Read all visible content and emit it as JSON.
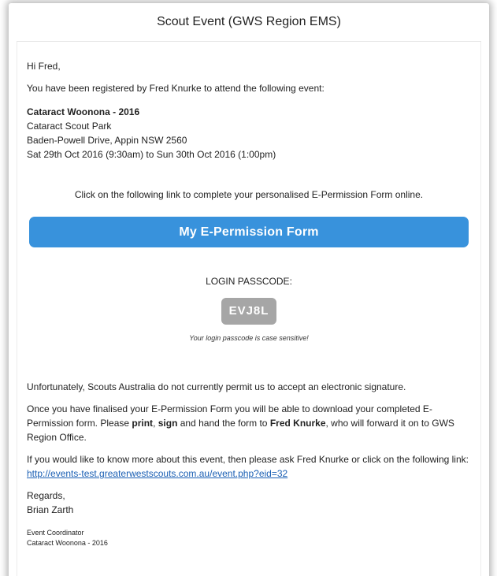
{
  "email": {
    "subject": "Scout Event (GWS Region EMS)",
    "greeting": "Hi Fred,",
    "intro": "You have been registered by Fred Knurke to attend the following event:",
    "event": {
      "name": "Cataract Woonona - 2016",
      "venue": "Cataract Scout Park",
      "address": "Baden-Powell Drive, Appin NSW 2560",
      "dates": "Sat 29th Oct 2016 (9:30am) to Sun 30th Oct 2016 (1:00pm)"
    },
    "link_instruction": "Click on the following link to complete your personalised E-Permission Form online.",
    "cta_label": "My E-Permission Form",
    "passcode_label": "LOGIN PASSCODE:",
    "passcode": "EVJ8L",
    "passcode_note": "Your login passcode is case sensitive!",
    "unfortunately": "Unfortunately, Scouts Australia do not currently permit us to accept an electronic signature.",
    "finalised": {
      "part1": "Once you have finalised your E-Permission Form you will be able to download your completed E-Permission form. Please ",
      "print": "print",
      "comma": ", ",
      "sign": "sign",
      "part2": " and hand the form to ",
      "person": "Fred Knurke",
      "part3": ", who will forward it on to GWS Region Office."
    },
    "more_info": {
      "text": "If you would like to know more about this event, then please ask Fred Knurke or click on the following link: ",
      "url": "http://events-test.greaterwestscouts.com.au/event.php?eid=32"
    },
    "regards": "Regards,",
    "sender": "Brian Zarth",
    "sender_role": "Event Coordinator",
    "sender_event": "Cataract Woonona - 2016"
  }
}
